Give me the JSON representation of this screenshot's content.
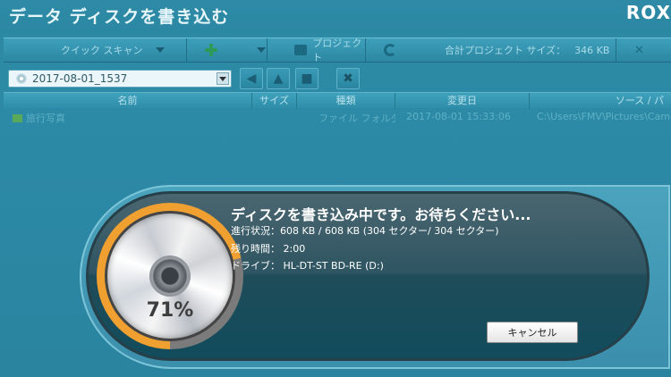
{
  "window": {
    "title": "データ ディスクを書き込む",
    "brand": "ROX"
  },
  "toolbar": {
    "quick_scan": "クイック スキャン",
    "project": "プロジェクト",
    "total_size_label": "合計プロジェクト サイズ：",
    "total_size_value": "346 KB"
  },
  "path": {
    "value": "2017-08-01_1537"
  },
  "table": {
    "headers": [
      "名前",
      "サイズ",
      "種類",
      "変更日",
      "ソース / パ"
    ],
    "rows": [
      {
        "name": "旅行写真",
        "size": "",
        "type": "ファイル フォルダー",
        "date": "2017-08-01 15:33:06",
        "source": "C:\\Users\\FMV\\Pictures\\Cam"
      }
    ]
  },
  "progress": {
    "title": "ディスクを書き込み中です。お待ちください...",
    "status_line": "進行状況：608 KB / 608 KB (304 セクター/ 304 セクター)",
    "remaining_line": "残り時間： 2:00",
    "drive_line": "ドライブ： HL-DT-ST BD-RE (D:)",
    "percent_text": "71%",
    "percent_value": 71,
    "cancel_label": "キャンセル"
  },
  "colors": {
    "accent_ring": "#f0a030",
    "background": "#2c8aa6"
  }
}
